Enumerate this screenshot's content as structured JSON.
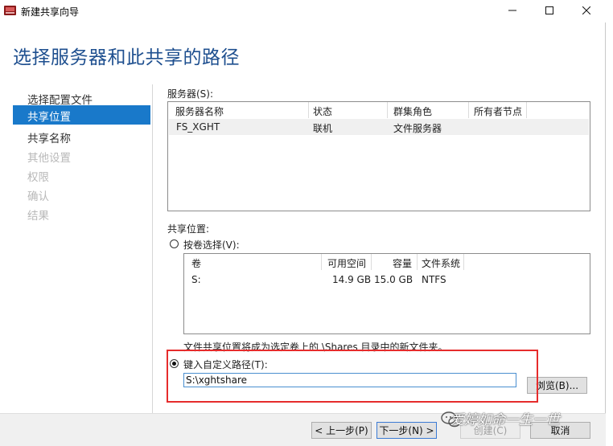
{
  "window": {
    "title": "新建共享向导",
    "minimize_glyph": "—",
    "maximize_glyph": "☐",
    "close_glyph": "✕"
  },
  "heading": "选择服务器和此共享的路径",
  "nav": {
    "items": [
      {
        "label": "选择配置文件",
        "state": "normal"
      },
      {
        "label": "共享位置",
        "state": "active"
      },
      {
        "label": "共享名称",
        "state": "normal"
      },
      {
        "label": "其他设置",
        "state": "disabled"
      },
      {
        "label": "权限",
        "state": "disabled"
      },
      {
        "label": "确认",
        "state": "disabled"
      },
      {
        "label": "结果",
        "state": "disabled"
      }
    ]
  },
  "server": {
    "label": "服务器(S):",
    "columns": [
      "服务器名称",
      "状态",
      "群集角色",
      "所有者节点"
    ],
    "rows": [
      [
        "FS_XGHT",
        "联机",
        "文件服务器",
        ""
      ]
    ]
  },
  "share_location": {
    "label": "共享位置:",
    "volume_radio_label": "按卷选择(V):",
    "volume_columns": [
      "卷",
      "可用空间",
      "容量",
      "文件系统"
    ],
    "volume_rows": [
      [
        "S:",
        "14.9 GB",
        "15.0 GB",
        "NTFS"
      ]
    ],
    "info_text": "文件共享位置将成为选定卷上的 \\Shares 目录中的新文件夹。",
    "custom_radio_label": "键入自定义路径(T):",
    "custom_path_value": "S:\\xghtshare",
    "browse_label": "浏览(B)...",
    "selected": "custom"
  },
  "footer": {
    "prev_label": "< 上一步(P)",
    "next_label": "下一步(N) >",
    "create_label": "创建(C)",
    "cancel_label": "取消"
  },
  "watermark": "爱婷如命一生一世",
  "colors": {
    "accent": "#1979ca",
    "heading": "#1e4f8f",
    "highlight": "#e62c2c"
  }
}
